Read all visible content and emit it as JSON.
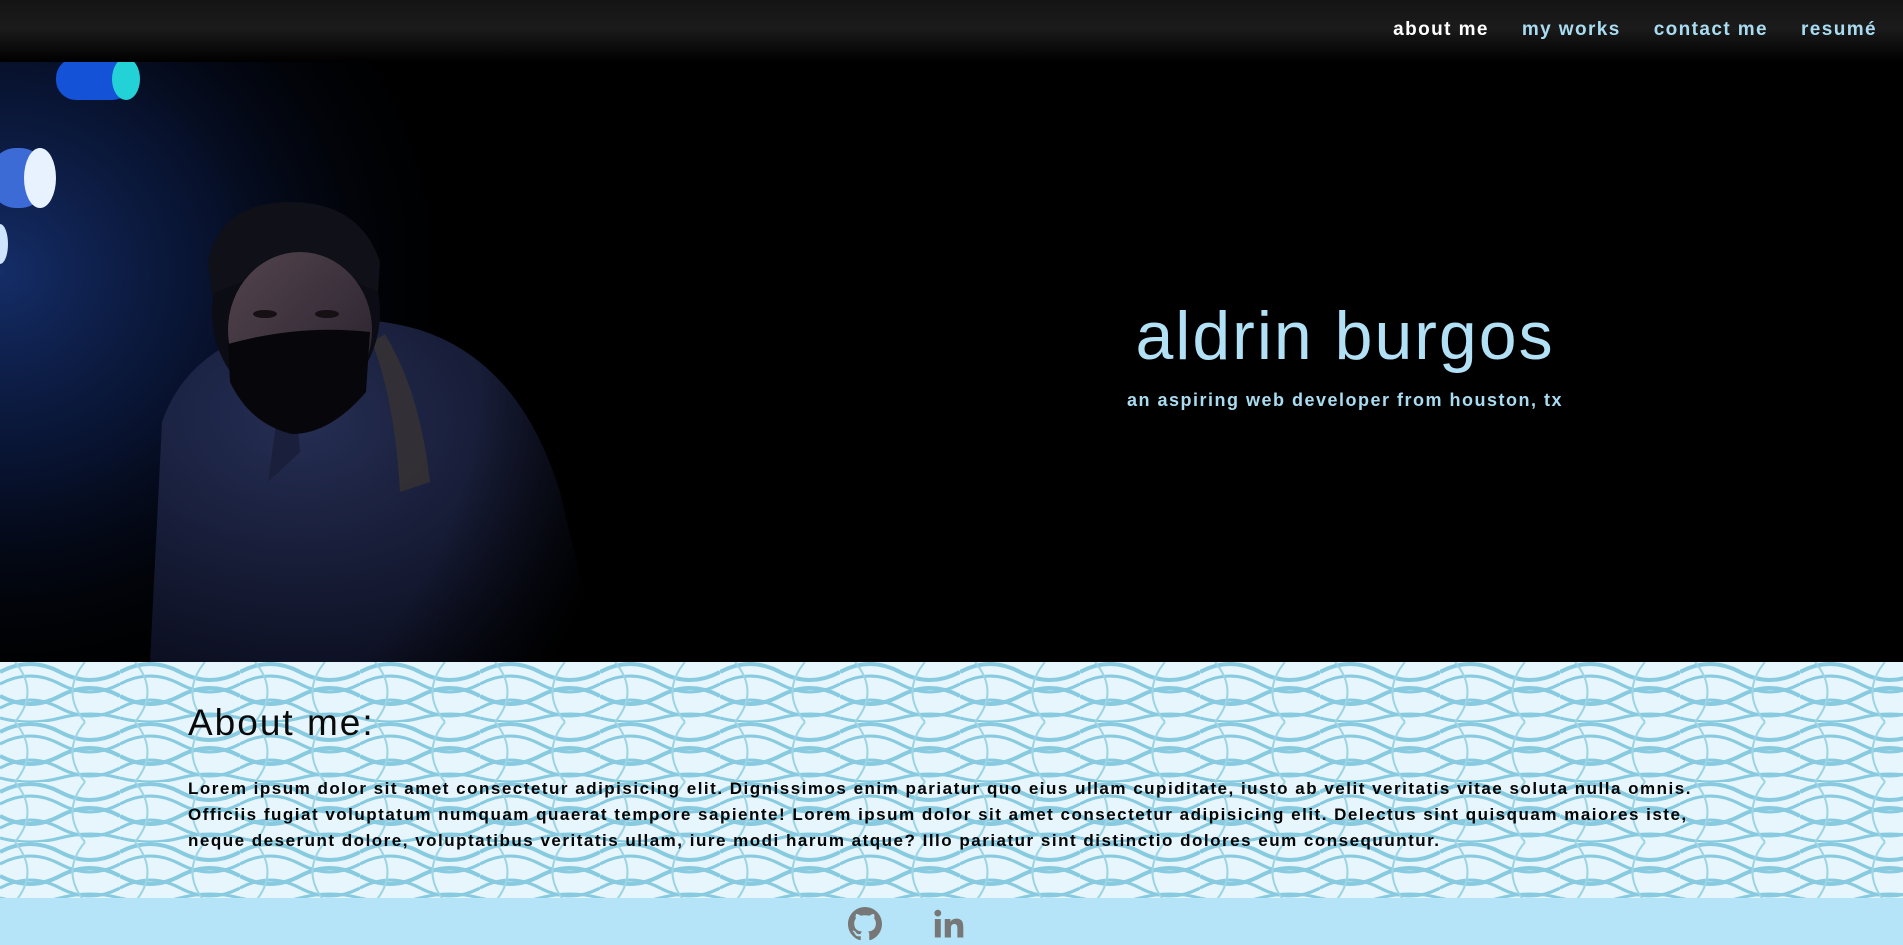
{
  "nav": {
    "items": [
      {
        "label": "about me",
        "active": true
      },
      {
        "label": "my works",
        "active": false
      },
      {
        "label": "contact me",
        "active": false
      },
      {
        "label": "resumé",
        "active": false
      }
    ]
  },
  "hero": {
    "name": "aldrin burgos",
    "tagline": "an aspiring web developer from houston, tx"
  },
  "about": {
    "title": "About me:",
    "body": "Lorem ipsum dolor sit amet consectetur adipisicing elit. Dignissimos enim pariatur quo eius ullam cupiditate, iusto ab velit veritatis vitae soluta nulla omnis. Officiis fugiat voluptatum numquam quaerat tempore sapiente! Lorem ipsum dolor sit amet consectetur adipisicing elit. Delectus sint quisquam maiores iste, neque deserunt dolore, voluptatibus veritatis ullam, iure modi harum atque? Illo pariatur sint distinctio dolores eum consequuntur."
  },
  "footer": {
    "icons": [
      "github-icon",
      "linkedin-icon"
    ]
  },
  "colors": {
    "accent": "#a9dcf1",
    "nav_active": "#ffffff",
    "footer_bg": "#b5e4f8",
    "pattern": "#8ccbe0"
  }
}
